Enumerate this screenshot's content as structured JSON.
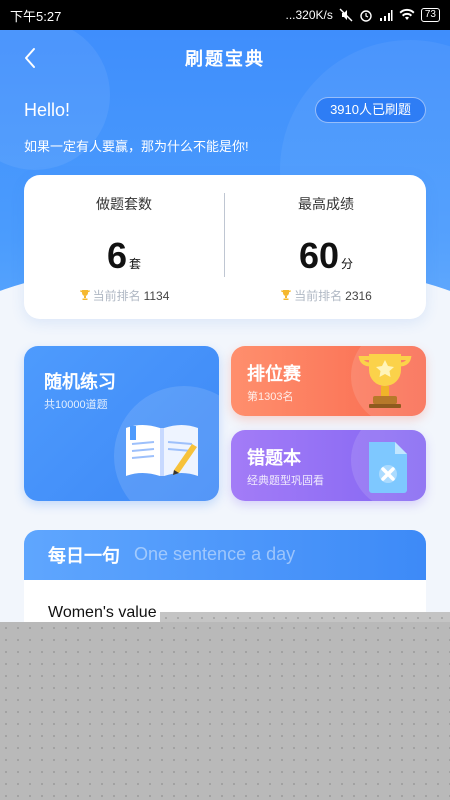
{
  "status_bar": {
    "time": "下午5:27",
    "network_speed": "...320K/s",
    "battery": "73"
  },
  "header": {
    "title": "刷题宝典"
  },
  "greeting": {
    "hello": "Hello!",
    "users_badge": "3910人已刷题",
    "slogan": "如果一定有人要赢，那为什么不能是你!"
  },
  "stats": {
    "sets": {
      "title": "做题套数",
      "value": "6",
      "unit": "套",
      "rank_label": "当前排名",
      "rank": "1134"
    },
    "best": {
      "title": "最高成绩",
      "value": "60",
      "unit": "分",
      "rank_label": "当前排名",
      "rank": "2316"
    }
  },
  "cards": {
    "random": {
      "title": "随机练习",
      "subtitle": "共10000道题"
    },
    "ranking": {
      "title": "排位赛",
      "subtitle": "第1303名"
    },
    "wrong_book": {
      "title": "错题本",
      "subtitle": "经典题型巩固看"
    }
  },
  "daily": {
    "title": "每日一句",
    "title_en": "One sentence a day",
    "quote": "Women's value"
  },
  "colors": {
    "primary": "#3f8efc",
    "ranking_card": "#f96a4f",
    "wrong_card": "#8466f2",
    "trophy": "#f5b82e"
  }
}
